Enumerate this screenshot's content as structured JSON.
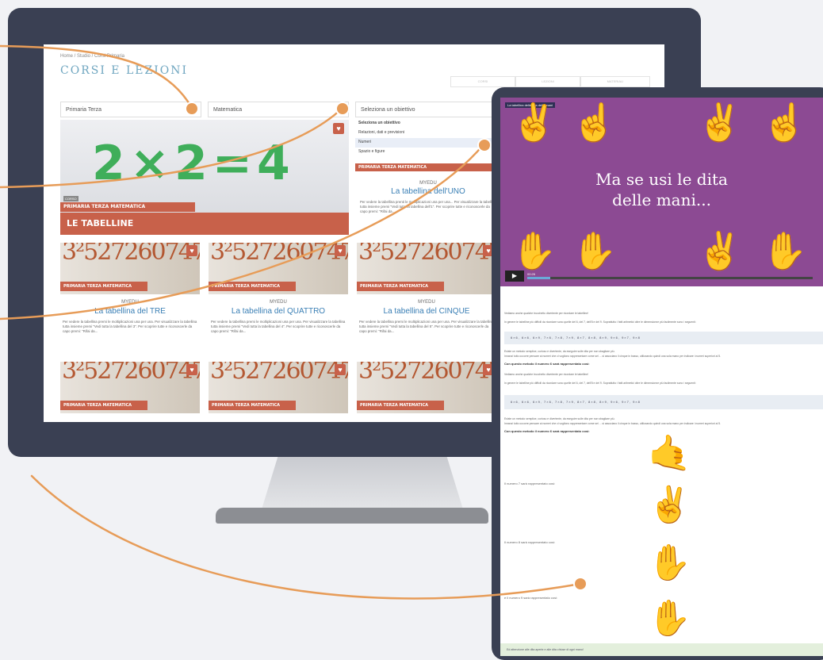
{
  "site": {
    "breadcrumb": "Home / Studio / Corsi Primaria",
    "title": "CORSI E LEZIONI",
    "top_tabs": [
      "CORSI",
      "LEZIONI",
      "MATERIALI"
    ]
  },
  "filters": {
    "grade": "Primaria Terza",
    "subject": "Matematica",
    "objective": "Seleziona un obiettivo",
    "objective_options": [
      "Seleziona un obiettivo",
      "Relazioni, dati e previsioni",
      "Numeri",
      "Spazio e figure"
    ]
  },
  "hero": {
    "tag": "CORSO",
    "category": "PRIMARIA TERZA MATEMATICA",
    "title": "LE TABELLINE",
    "image_text": "2×2=4"
  },
  "cards": [
    {
      "category": "PRIMARIA TERZA MATEMATICA",
      "brand": "MYEDU",
      "title": "La tabellina dell'UNO",
      "desc": "Per vedere la tabellina prenti le moltiplicazioni una per una... Per visualizzare la tabellina tutta insieme premi \"Vedi tutta la tabellina dell'1\". Per scoprire tutte e riconoscerle da capo premi: \"Rifai da..."
    },
    {
      "category": "PRIMARIA TERZA MATEMATICA",
      "brand": "MYEDU",
      "title": "La tabellina del TRE",
      "desc": "Per vedere la tabellina premi le moltiplicazioni una per una. Per visualizzare la tabellina tutta insieme premi \"Vedi tutta la tabellina del 3\". Per scoprire tutte e riconoscerle da capo premi: \"Rifai da..."
    },
    {
      "category": "PRIMARIA TERZA MATEMATICA",
      "brand": "MYEDU",
      "title": "La tabellina del QUATTRO",
      "desc": "Per vedere la tabellina premi le moltiplicazioni una per una. Per visualizzare la tabellina tutta insieme premi \"Vedi tutta la tabellina del 4\". Per scoprire tutte e riconoscerle da capo premi: \"Rifai da..."
    },
    {
      "category": "PRIMARIA TERZA MATEMATICA",
      "brand": "MYEDU",
      "title": "La tabellina del CINQUE",
      "desc": "Per vedere la tabellina premi le moltiplicazioni una per una. Per visualizzare la tabellina tutta insieme premi \"Vedi tutta la tabellina del 5\". Per scoprire tutte e riconoscerle da capo premi: \"Rifai da..."
    },
    {
      "category": "PRIMARIA TERZA MATEMATICA"
    },
    {
      "category": "PRIMARIA TERZA MATEMATICA"
    },
    {
      "category": "PRIMARIA TERZA MATEMATICA"
    }
  ],
  "thumb_digits": "3²527260747³",
  "heart_icon": "heart-icon",
  "lesson": {
    "video_label": "La tabellina delle dita delle mani",
    "video_title_line1": "Ma se usi le dita",
    "video_title_line2": "delle mani...",
    "video_time": "00:26",
    "intro_q": "Vediamo anche qualche trucchetto divertente per ricordare le tabelline!",
    "intro": "In genere le tabelline più difficili da ricordare sono quelle del 6, del 7, dell'8 e del 9. Soprattutto i fatti aritmetici oltre le dimensionne più facilmente sono i seguenti:",
    "facts": "6×6, 6×6, 6×9, 7×6, 7×8, 7×9, 8×7, 8×8, 8×9, 9×6, 9×7, 9×8",
    "explain1": "Esiste un metodo semplice, curioso e divertente, da eseguire sulle dita per non sbagliare più.",
    "explain2": "Innanzi tutto occorre pensare ai numeri che ci vogliono rappresentare come sei ... si associano il cinque in basso, utilizzando quindi una sola mano per indicare i numeri superiori al 5.",
    "method_head": "Con questo metodo il numero 6 sarà rappresentato così:",
    "method_head_bold": "numero 6",
    "number_7": "Il numero 7 sarà rappresentato così:",
    "number_8": "Il numero 8 sarà rappresentato così:",
    "number_9": "e il numero 9 sarà rappresentato così:",
    "footer_note": "Ed attenzione alle dita aperte e alle dita chiuse di ogni mano!"
  },
  "colors": {
    "accent_orange": "#e79c58",
    "frame_navy": "#3a4053",
    "brand_red": "#c8614a",
    "title_blue": "#3a7fb5",
    "video_purple": "#8c4a93"
  }
}
